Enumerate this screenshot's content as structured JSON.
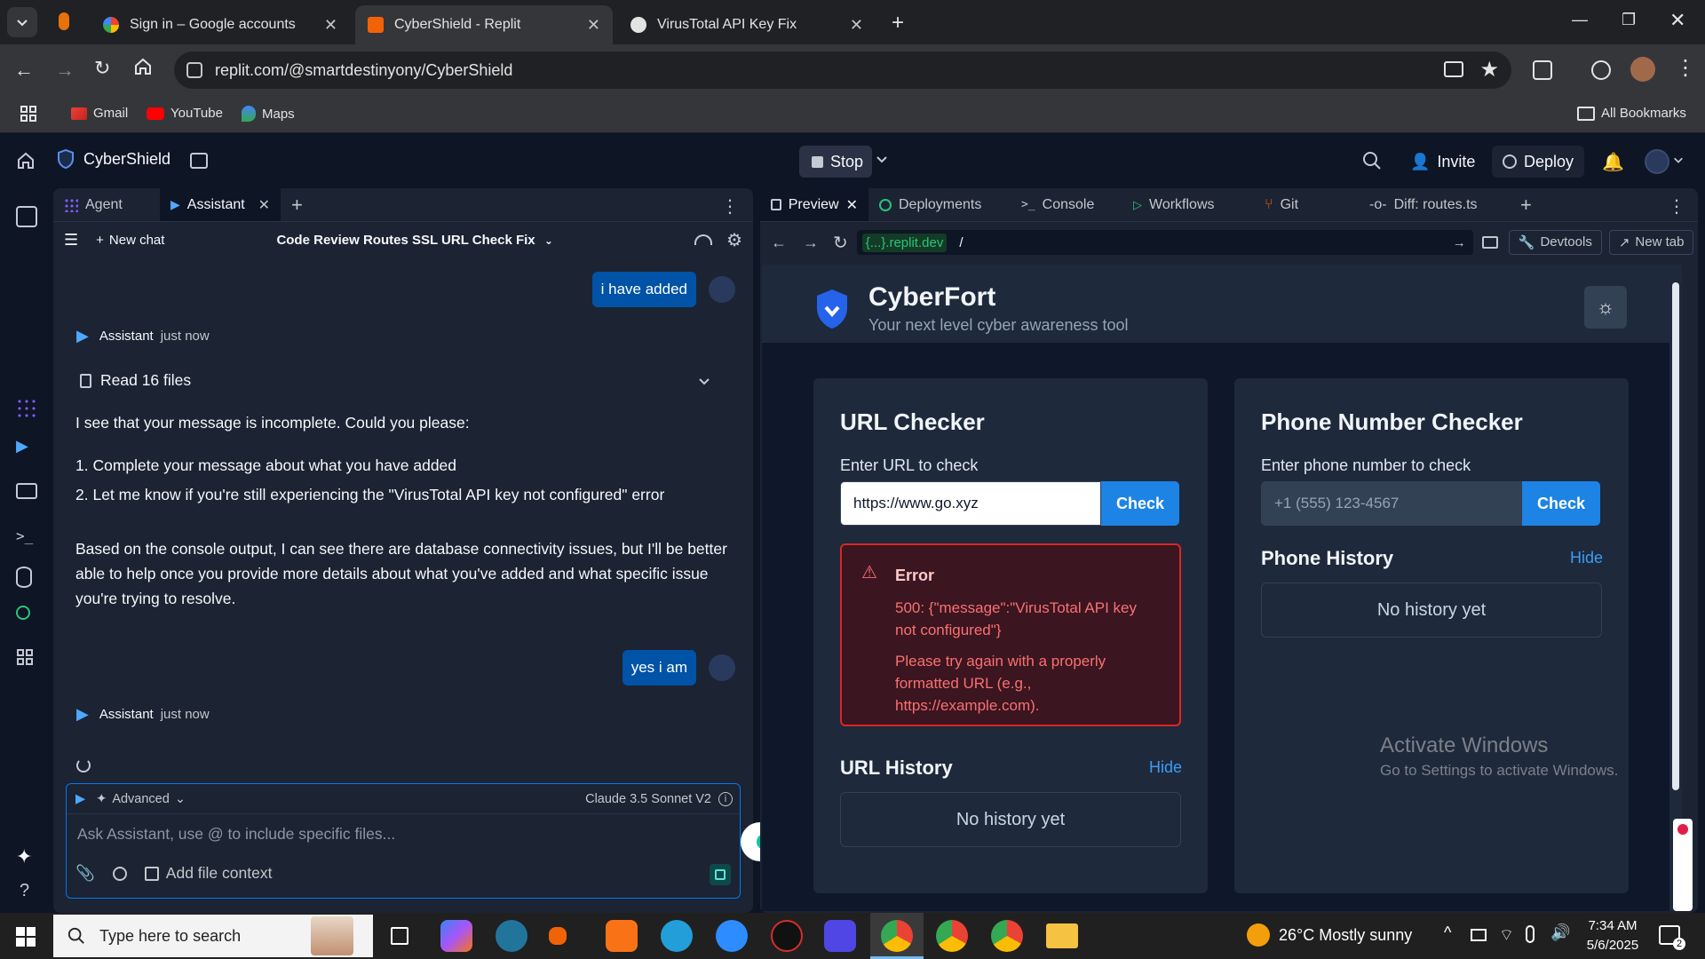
{
  "browser": {
    "tabs": [
      {
        "title": "Sign in – Google accounts",
        "active": false
      },
      {
        "title": "CyberShield - Replit",
        "active": true
      },
      {
        "title": "VirusTotal API Key Fix",
        "active": false
      }
    ],
    "url": "replit.com/@smartdestinyony/CyberShield",
    "bookmarks": [
      "Gmail",
      "YouTube",
      "Maps"
    ],
    "all_bookmarks": "All Bookmarks"
  },
  "replit": {
    "project_name": "CyberShield",
    "stop_label": "Stop",
    "invite_label": "Invite",
    "deploy_label": "Deploy",
    "left_tabs": {
      "agent": "Agent",
      "assistant": "Assistant"
    },
    "new_chat": "New chat",
    "chat_title": "Code Review Routes SSL URL Check Fix",
    "messages": {
      "user1": "i have added",
      "assistant_name": "Assistant",
      "time": "just now",
      "read_files": "Read 16 files",
      "p1": "I see that your message is incomplete. Could you please:",
      "li1": "1. Complete your message about what you have added",
      "li2": "2. Let me know if you're still experiencing the \"VirusTotal API key not configured\" error",
      "p2": "Based on the console output, I can see there are database connectivity issues, but I'll be better able to help once you provide more details about what you've added and what specific issue you're trying to resolve.",
      "user2": "yes i am"
    },
    "composer": {
      "advanced": "Advanced",
      "model": "Claude 3.5 Sonnet V2",
      "placeholder": "Ask Assistant, use @ to include specific files...",
      "add_context": "Add file context"
    },
    "right_tabs": [
      "Preview",
      "Deployments",
      "Console",
      "Workflows",
      "Git",
      "Diff: routes.ts"
    ],
    "preview_domain": "{...}.replit.dev",
    "preview_path": "/",
    "devtools": "Devtools",
    "new_tab": "New tab"
  },
  "site": {
    "name": "CyberFort",
    "tagline": "Your next level cyber awareness tool",
    "url_checker": {
      "title": "URL Checker",
      "label": "Enter URL to check",
      "value": "https://www.go.xyz",
      "button": "Check",
      "error_title": "Error",
      "error_msg": "500: {\"message\":\"VirusTotal API key not configured\"}",
      "error_hint": "Please try again with a properly formatted URL (e.g., https://example.com).",
      "history_title": "URL History",
      "hide": "Hide",
      "empty": "No history yet"
    },
    "phone_checker": {
      "title": "Phone Number Checker",
      "label": "Enter phone number to check",
      "placeholder": "+1 (555) 123-4567",
      "button": "Check",
      "history_title": "Phone History",
      "hide": "Hide",
      "empty": "No history yet"
    },
    "watermark_title": "Activate Windows",
    "watermark_sub": "Go to Settings to activate Windows."
  },
  "taskbar": {
    "search_placeholder": "Type here to search",
    "weather": "26°C  Mostly sunny",
    "time": "7:34 AM",
    "date": "5/6/2025",
    "notifications": "2"
  },
  "colors": {
    "accent": "#1d83e4",
    "error": "#f87171",
    "user_bubble": "#0053a6"
  }
}
